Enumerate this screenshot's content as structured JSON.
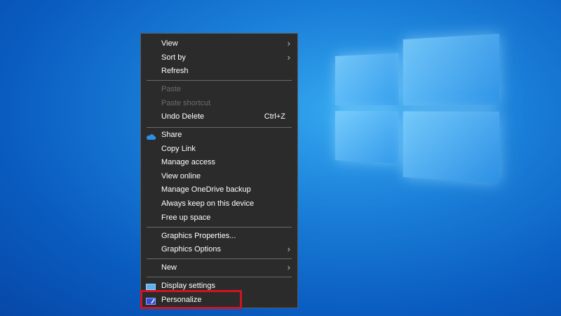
{
  "menu": {
    "view": "View",
    "sort_by": "Sort by",
    "refresh": "Refresh",
    "paste": "Paste",
    "paste_shortcut": "Paste shortcut",
    "undo_delete": "Undo Delete",
    "undo_shortcut": "Ctrl+Z",
    "share": "Share",
    "copy_link": "Copy Link",
    "manage_access": "Manage access",
    "view_online": "View online",
    "manage_onedrive_backup": "Manage OneDrive backup",
    "always_keep": "Always keep on this device",
    "free_up_space": "Free up space",
    "graphics_properties": "Graphics Properties...",
    "graphics_options": "Graphics Options",
    "new": "New",
    "display_settings": "Display settings",
    "personalize": "Personalize"
  },
  "colors": {
    "highlight": "#d01420",
    "menu_bg": "#2b2b2b"
  }
}
